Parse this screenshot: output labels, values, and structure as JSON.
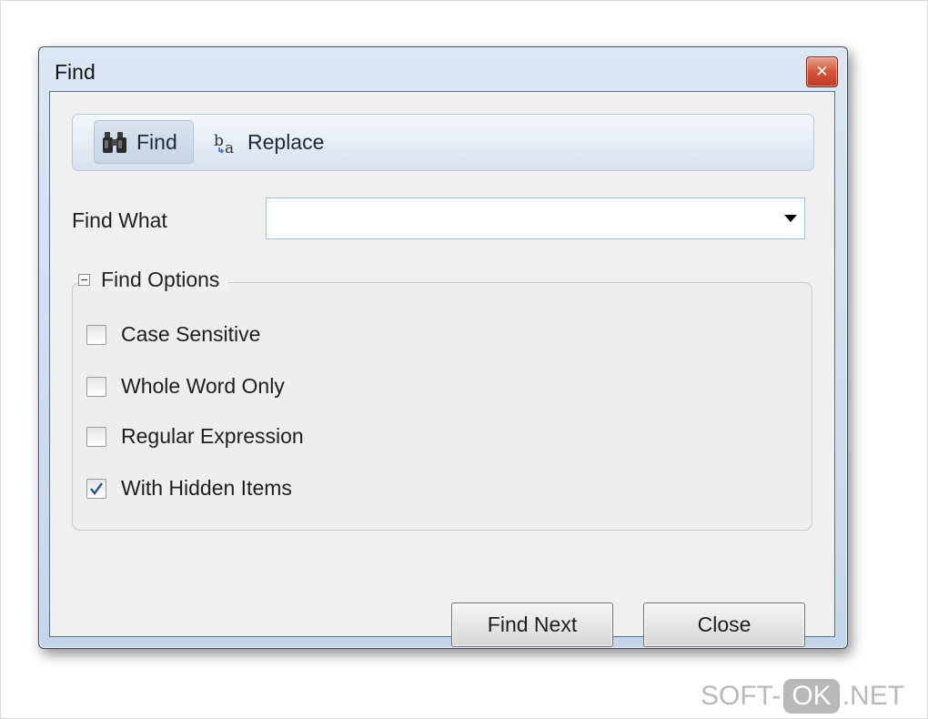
{
  "window": {
    "title": "Find",
    "close_glyph": "✕"
  },
  "tabs": [
    {
      "label": "Find",
      "icon": "binoculars-icon",
      "selected": true
    },
    {
      "label": "Replace",
      "icon": "replace-icon",
      "selected": false
    }
  ],
  "find_what": {
    "label": "Find What",
    "value": ""
  },
  "find_options": {
    "title": "Find Options",
    "expanded": true,
    "items": [
      {
        "label": "Case Sensitive",
        "checked": false
      },
      {
        "label": "Whole Word Only",
        "checked": false
      },
      {
        "label": "Regular Expression",
        "checked": false
      },
      {
        "label": "With Hidden Items",
        "checked": true
      }
    ]
  },
  "buttons": {
    "find_next": "Find Next",
    "close": "Close"
  },
  "watermark": {
    "prefix": "SOFT-",
    "badge": "OK",
    "suffix": ".NET"
  },
  "colors": {
    "title_bar": "#c6d6ea",
    "close_button": "#c03a22",
    "client_background": "#f0f0f0",
    "check_mark": "#2b55a0"
  }
}
